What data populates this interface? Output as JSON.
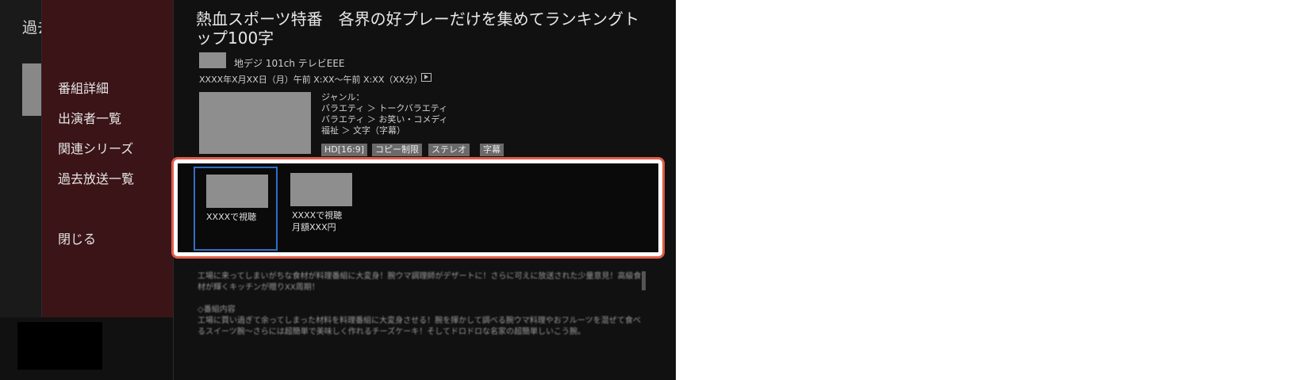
{
  "background": {
    "title": "過去"
  },
  "menu": {
    "items": [
      "番組詳細",
      "出演者一覧",
      "関連シリーズ",
      "過去放送一覧"
    ],
    "close": "閉じる"
  },
  "program": {
    "title": "熱血スポーツ特番　各界の好プレーだけを集めてランキングトップ100字",
    "channel": "地デジ 101ch テレビEEE",
    "datetime": "XXXX年X月XX日（月）午前 X:XX～午前 X:XX（XX分）",
    "genre_label": "ジャンル：",
    "genres": [
      "バラエティ ＞ トークバラエティ",
      "バラエティ ＞ お笑い・コメディ",
      "福祉 ＞ 文字（字幕）"
    ],
    "tags": [
      "HD[16:9]",
      "コピー制限",
      "ステレオ",
      "字幕"
    ]
  },
  "actions": [
    {
      "label": "XXXXで視聴",
      "sub": ""
    },
    {
      "label": "XXXXで視聴",
      "sub": "月額XXX円"
    }
  ],
  "description": {
    "para1": "工場に来ってしまいがちな食材が料理番組に大変身！腕ウマ調理師がデザートに！さらに可えに放送された少量意見！高級食材が輝くキッチンが贈りXX周期！",
    "heading": "◇番組内容",
    "para2": "工場に買い過ぎて余ってしまった材料を料理番組に大変身させる！腕を揮かして調べる腕ウマ料理やおフルーツを混ぜて食べるスイーツ腕～さらには超簡単で美味しく作れるチーズケーキ！そしてドロドロな名家の超簡単しいこう腕。"
  }
}
